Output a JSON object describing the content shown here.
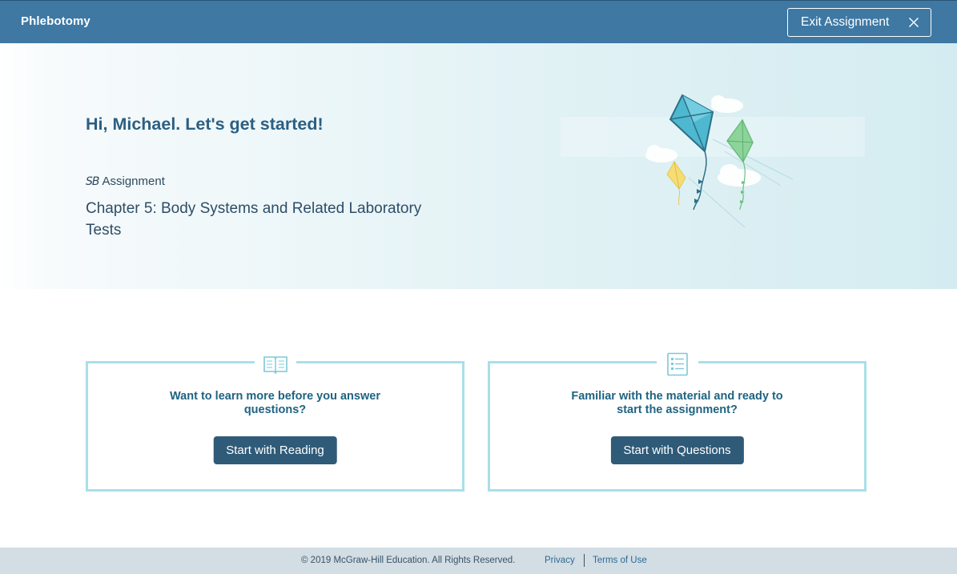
{
  "header": {
    "app_title": "Phlebotomy",
    "exit_label": "Exit Assignment",
    "exit_icon": "close-icon"
  },
  "hero": {
    "greeting": "Hi, Michael. Let's get started!",
    "badge_logo": "SB",
    "badge_label": "Assignment",
    "chapter_title": "Chapter 5: Body Systems and Related Laboratory Tests",
    "illustration": "kites-illustration"
  },
  "cards": [
    {
      "icon": "open-book-icon",
      "prompt": "Want to learn more before you answer questions?",
      "button_label": "Start with Reading"
    },
    {
      "icon": "question-list-icon",
      "prompt": "Familiar with the material and ready to start the assignment?",
      "button_label": "Start with Questions"
    }
  ],
  "footer": {
    "copyright": "© 2019 McGraw-Hill Education. All Rights Reserved.",
    "privacy_label": "Privacy",
    "terms_label": "Terms of Use"
  },
  "colors": {
    "header_bg": "#3e78a3",
    "button_bg": "#2f5b79",
    "card_border": "#a9dfe8",
    "footer_bg": "#d2dde4",
    "heading": "#2c5f82"
  }
}
